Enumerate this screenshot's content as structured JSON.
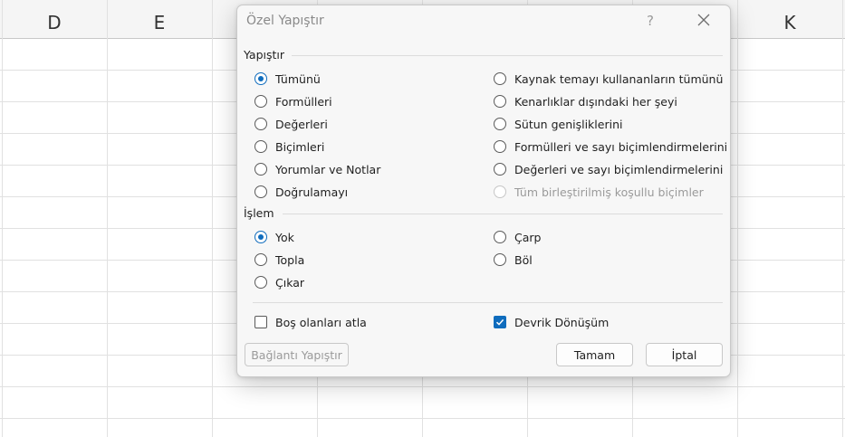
{
  "sheet": {
    "columns": {
      "d": "D",
      "e": "E",
      "k": "K"
    }
  },
  "dialog": {
    "title": "Özel Yapıştır",
    "help_icon": "?",
    "close_icon": "close-icon",
    "paste_section_label": "Yapıştır",
    "paste_options_left": [
      {
        "label": "Tümünü",
        "checked": true
      },
      {
        "label": "Formülleri",
        "checked": false
      },
      {
        "label": "Değerleri",
        "checked": false
      },
      {
        "label": "Biçimleri",
        "checked": false
      },
      {
        "label": "Yorumlar ve Notlar",
        "checked": false
      },
      {
        "label": "Doğrulamayı",
        "checked": false
      }
    ],
    "paste_options_right": [
      {
        "label": "Kaynak temayı kullananların tümünü",
        "checked": false,
        "disabled": false
      },
      {
        "label": "Kenarlıklar dışındaki her şeyi",
        "checked": false,
        "disabled": false
      },
      {
        "label": "Sütun genişliklerini",
        "checked": false,
        "disabled": false
      },
      {
        "label": "Formülleri ve sayı biçimlendirmelerini",
        "checked": false,
        "disabled": false
      },
      {
        "label": "Değerleri ve sayı biçimlendirmelerini",
        "checked": false,
        "disabled": false
      },
      {
        "label": "Tüm birleştirilmiş koşullu biçimler",
        "checked": false,
        "disabled": true
      }
    ],
    "operation_section_label": "İşlem",
    "operation_options_left": [
      {
        "label": "Yok",
        "checked": true
      },
      {
        "label": "Topla",
        "checked": false
      },
      {
        "label": "Çıkar",
        "checked": false
      }
    ],
    "operation_options_right": [
      {
        "label": "Çarp",
        "checked": false
      },
      {
        "label": "Böl",
        "checked": false
      }
    ],
    "skip_blanks": {
      "label": "Boş olanları atla",
      "checked": false
    },
    "transpose": {
      "label": "Devrik Dönüşüm",
      "checked": true
    },
    "paste_link_button": "Bağlantı Yapıştır",
    "ok_button": "Tamam",
    "cancel_button": "İptal",
    "accent_color": "#0f6cbd"
  }
}
